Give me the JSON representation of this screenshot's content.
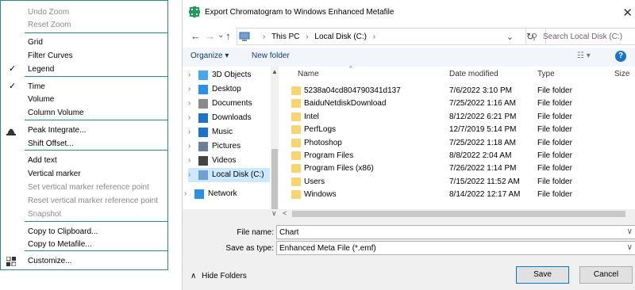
{
  "context_menu": {
    "items": [
      {
        "label": "Undo Zoom",
        "disabled": true
      },
      {
        "label": "Reset Zoom",
        "disabled": true
      },
      {
        "label": "Grid"
      },
      {
        "label": "Filter Curves"
      },
      {
        "label": "Legend",
        "checked": true
      },
      {
        "label": "Time",
        "checked": true
      },
      {
        "label": "Volume"
      },
      {
        "label": "Column Volume"
      },
      {
        "label": "Peak Integrate...",
        "icon": "peak-icon"
      },
      {
        "label": "Shift Offset..."
      },
      {
        "label": "Add text"
      },
      {
        "label": "Vertical marker"
      },
      {
        "label": "Set vertical marker reference point",
        "disabled": true
      },
      {
        "label": "Reset vertical marker reference point",
        "disabled": true
      },
      {
        "label": "Snapshot",
        "disabled": true
      },
      {
        "label": "Copy to Clipboard..."
      },
      {
        "label": "Copy to Metafile..."
      },
      {
        "label": "Customize...",
        "icon": "customize-icon"
      }
    ],
    "check_mark": "✓",
    "colors": {
      "accent": "#2e8a7e",
      "disabled": "#8a8a8a"
    }
  },
  "dialog": {
    "title": "Export Chromatogram to Windows Enhanced Metafile",
    "close": "✕",
    "nav": {
      "back": "←",
      "forward": "→",
      "dropdown": "⌄",
      "up": "↑"
    },
    "address": {
      "crumbs": [
        "This PC",
        "Local Disk (C:)"
      ],
      "separator": "›"
    },
    "search_placeholder": "Search Local Disk (C:)",
    "toolbar": {
      "organize": "Organize ▾",
      "new_folder": "New folder",
      "view": "☷ ▾",
      "help": "?"
    },
    "tree": [
      {
        "label": "3D Objects",
        "icon": "3d-objects-icon",
        "color": "#49a6e9"
      },
      {
        "label": "Desktop",
        "icon": "desktop-icon",
        "color": "#2f8ee5"
      },
      {
        "label": "Documents",
        "icon": "documents-icon",
        "color": "#8a8a8a"
      },
      {
        "label": "Downloads",
        "icon": "downloads-icon",
        "color": "#1e72c8"
      },
      {
        "label": "Music",
        "icon": "music-icon",
        "color": "#1e72c8"
      },
      {
        "label": "Pictures",
        "icon": "pictures-icon",
        "color": "#6b7f96"
      },
      {
        "label": "Videos",
        "icon": "videos-icon",
        "color": "#444"
      },
      {
        "label": "Local Disk (C:)",
        "icon": "local-disk-icon",
        "color": "#6fa0cf",
        "selected": true
      },
      {
        "label": "Network",
        "icon": "network-icon",
        "color": "#2f8ee5"
      }
    ],
    "columns": {
      "name": "Name",
      "date": "Date modified",
      "type": "Type",
      "size": "Size"
    },
    "files": [
      {
        "name": "5238a04cd804790341d137",
        "date": "7/6/2022 3:10 PM",
        "type": "File folder"
      },
      {
        "name": "BaiduNetdiskDownload",
        "date": "7/25/2022 1:16 AM",
        "type": "File folder"
      },
      {
        "name": "Intel",
        "date": "8/12/2022 6:21 PM",
        "type": "File folder"
      },
      {
        "name": "PerfLogs",
        "date": "12/7/2019 5:14 PM",
        "type": "File folder"
      },
      {
        "name": "Photoshop",
        "date": "7/25/2022 1:18 AM",
        "type": "File folder"
      },
      {
        "name": "Program Files",
        "date": "8/8/2022 2:04 AM",
        "type": "File folder"
      },
      {
        "name": "Program Files (x86)",
        "date": "7/26/2022 1:14 PM",
        "type": "File folder"
      },
      {
        "name": "Users",
        "date": "7/15/2022 11:52 AM",
        "type": "File folder"
      },
      {
        "name": "Windows",
        "date": "8/14/2022 12:17 AM",
        "type": "File folder"
      }
    ],
    "file_name_label": "File name:",
    "file_name_value": "Chart",
    "save_type_label": "Save as type:",
    "save_type_value": "Enhanced Meta File (*.emf)",
    "hide_folders": "Hide Folders",
    "save_button": "Save",
    "cancel_button": "Cancel"
  }
}
